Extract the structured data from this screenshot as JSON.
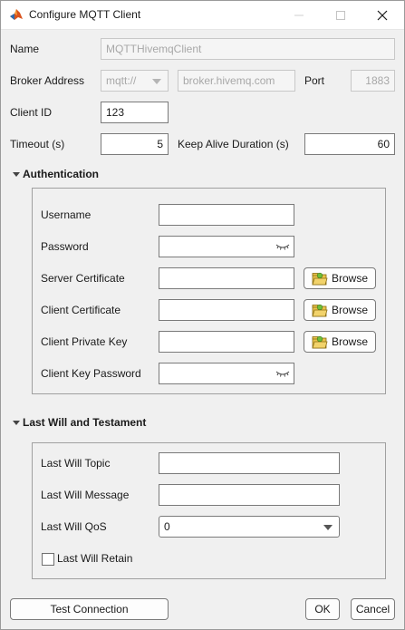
{
  "window": {
    "title": "Configure MQTT Client",
    "min_glyph": "—",
    "max_glyph": "☐",
    "close_glyph": "✕"
  },
  "general": {
    "name_label": "Name",
    "name_value": "MQTTHivemqClient",
    "broker_label": "Broker Address",
    "broker_scheme": "mqtt://",
    "broker_host": "broker.hivemq.com",
    "port_label": "Port",
    "port_value": "1883",
    "client_id_label": "Client ID",
    "client_id_value": "123",
    "timeout_label": "Timeout (s)",
    "timeout_value": "5",
    "keepalive_label": "Keep Alive Duration (s)",
    "keepalive_value": "60"
  },
  "auth": {
    "heading": "Authentication",
    "username_label": "Username",
    "username_value": "",
    "password_label": "Password",
    "password_value": "",
    "server_cert_label": "Server Certificate",
    "client_cert_label": "Client Certificate",
    "client_key_label": "Client Private Key",
    "client_key_password_label": "Client Key Password",
    "browse_label": "Browse"
  },
  "will": {
    "heading": "Last Will and Testament",
    "topic_label": "Last Will Topic",
    "topic_value": "",
    "message_label": "Last Will Message",
    "message_value": "",
    "qos_label": "Last Will QoS",
    "qos_value": "0",
    "retain_label": "Last Will Retain",
    "retain_checked": false
  },
  "footer": {
    "test_label": "Test Connection",
    "ok_label": "OK",
    "cancel_label": "Cancel"
  },
  "icons": {
    "app": "matlab-logo-icon",
    "browse": "folder-open-icon",
    "password_toggle": "eye-closed-icon"
  }
}
